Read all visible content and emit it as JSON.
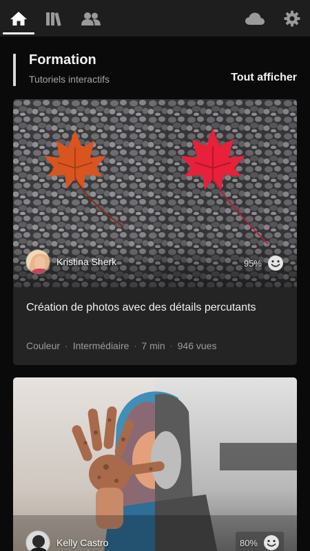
{
  "nav": {
    "items": [
      {
        "icon": "home-icon",
        "active": true
      },
      {
        "icon": "library-icon",
        "active": false
      },
      {
        "icon": "people-icon",
        "active": false
      },
      {
        "icon": "cloud-icon",
        "active": false
      },
      {
        "icon": "gear-icon",
        "active": false
      }
    ]
  },
  "section": {
    "title": "Formation",
    "subtitle": "Tutoriels interactifs",
    "see_all": "Tout afficher"
  },
  "tutorials": [
    {
      "author": "Kristina Sherk",
      "rating_percent": "95%",
      "title": "Création de photos avec des détails percutants",
      "meta": {
        "category": "Couleur",
        "level": "Intermédiaire",
        "duration": "7 min",
        "views": "946 vues"
      }
    },
    {
      "author": "Kelly Castro",
      "rating_percent": "80%"
    }
  ],
  "colors": {
    "background": "#0a0a0a",
    "nav_background": "#1e1e1e",
    "card_background": "#242424",
    "muted_text": "#9c9c9c"
  }
}
